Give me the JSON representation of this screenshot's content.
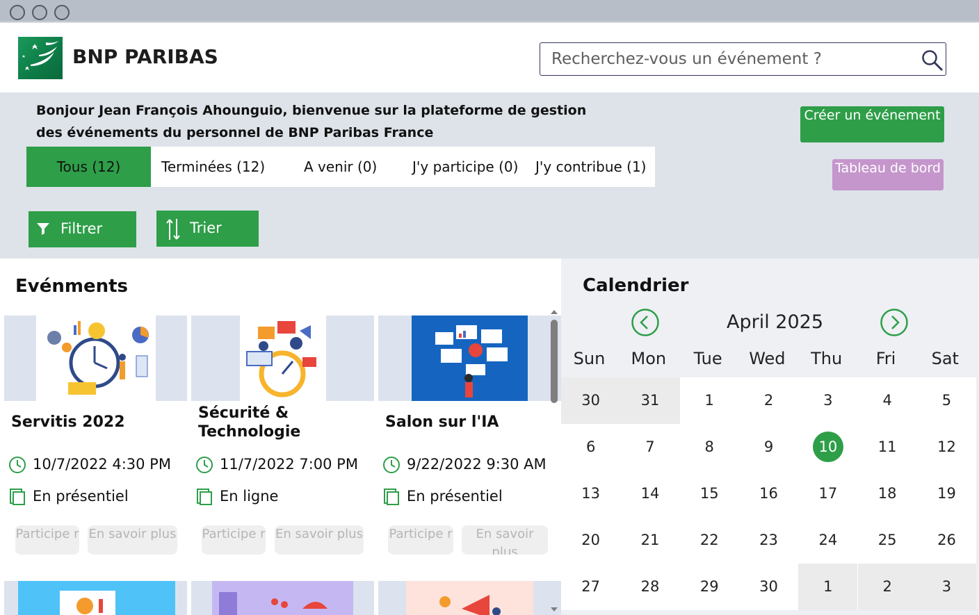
{
  "window": {
    "controls": [
      "close",
      "minimize",
      "maximize"
    ]
  },
  "brand": {
    "name": "BNP PARIBAS",
    "color": "#0d7a46"
  },
  "search": {
    "placeholder": "Recherchez-vous un événement ?"
  },
  "welcome": {
    "text": "Bonjour Jean François Ahounguio, bienvenue sur la plateforme de gestion des événements du personnel de BNP Paribas France"
  },
  "actions": {
    "create_label": "Créer un événement",
    "dashboard_label": "Tableau de bord"
  },
  "tabs": [
    {
      "label": "Tous (12)",
      "active": true
    },
    {
      "label": "Terminées (12)",
      "active": false
    },
    {
      "label": "A venir (0)",
      "active": false
    },
    {
      "label": "J'y participe (0)",
      "active": false
    },
    {
      "label": "J'y contribue (1)",
      "active": false
    }
  ],
  "toolbar": {
    "filter_label": "Filtrer",
    "sort_label": "Trier"
  },
  "events": {
    "title": "Evénments",
    "participate_label": "Participe r",
    "more_label": "En savoir plus",
    "cards": [
      {
        "title": "Servitis 2022",
        "datetime": "10/7/2022 4:30 PM",
        "mode": "En présentiel"
      },
      {
        "title": "Sécurité & Technologie",
        "datetime": "11/7/2022 7:00 PM",
        "mode": "En ligne"
      },
      {
        "title": "Salon sur l'IA",
        "datetime": "9/22/2022 9:30 AM",
        "mode": "En présentiel"
      }
    ]
  },
  "calendar": {
    "title": "Calendrier",
    "month_label": "April 2025",
    "weekdays": [
      "Sun",
      "Mon",
      "Tue",
      "Wed",
      "Thu",
      "Fri",
      "Sat"
    ],
    "days": [
      [
        "30",
        "31",
        "1",
        "2",
        "3",
        "4",
        "5"
      ],
      [
        "6",
        "7",
        "8",
        "9",
        "10",
        "11",
        "12"
      ],
      [
        "13",
        "14",
        "15",
        "16",
        "17",
        "18",
        "19"
      ],
      [
        "20",
        "21",
        "22",
        "23",
        "24",
        "25",
        "26"
      ],
      [
        "27",
        "28",
        "29",
        "30",
        "1",
        "2",
        "3"
      ]
    ],
    "selected_day": "10",
    "accent_color": "#2e9e48"
  },
  "colors": {
    "accent": "#2e9e48",
    "dashboard": "#c596cc",
    "band": "#dde3e9"
  }
}
